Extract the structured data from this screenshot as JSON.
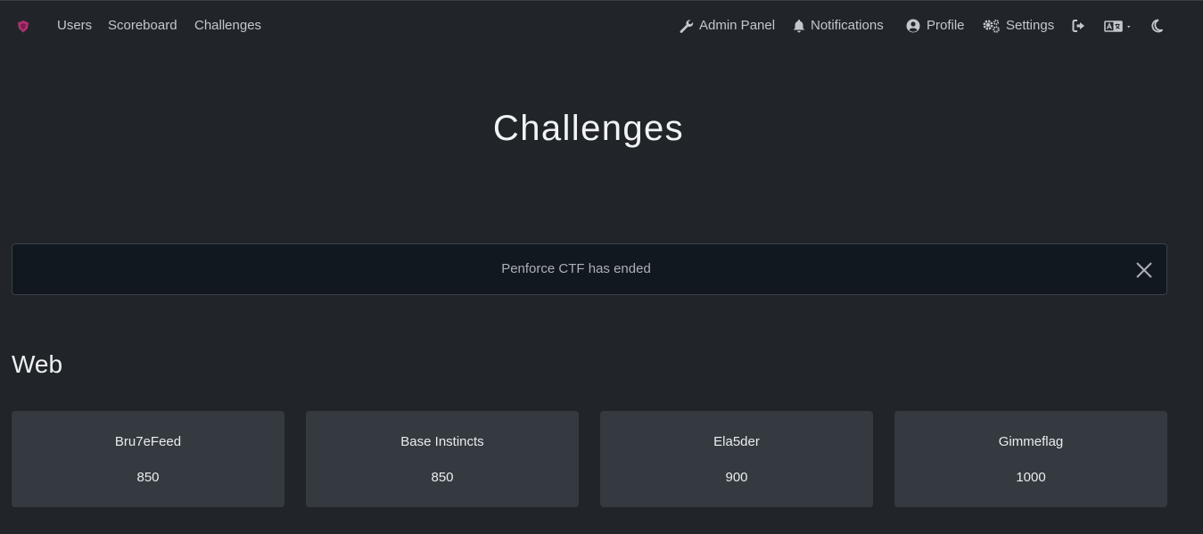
{
  "nav": {
    "left_links": [
      "Users",
      "Scoreboard",
      "Challenges"
    ],
    "admin_panel": "Admin Panel",
    "notifications": "Notifications",
    "profile": "Profile",
    "settings": "Settings"
  },
  "icons": {
    "brand": "shield-logo-icon",
    "admin": "wrench-icon",
    "notifications": "bell-icon",
    "profile": "user-circle-icon",
    "settings": "cogs-icon",
    "logout": "sign-out-icon",
    "language": "language-icon",
    "theme": "moon-icon",
    "close": "close-icon"
  },
  "colors": {
    "background": "#212529",
    "alert_background": "#121820",
    "card_background": "#343a40",
    "brand": "#b0306f"
  },
  "page": {
    "title": "Challenges"
  },
  "alert": {
    "text": "Penforce CTF has ended"
  },
  "categories": [
    {
      "name": "Web",
      "challenges": [
        {
          "name": "Bru7eFeed",
          "value": "850"
        },
        {
          "name": "Base Instincts",
          "value": "850"
        },
        {
          "name": "Ela5der",
          "value": "900"
        },
        {
          "name": "Gimmeflag",
          "value": "1000"
        }
      ]
    }
  ]
}
